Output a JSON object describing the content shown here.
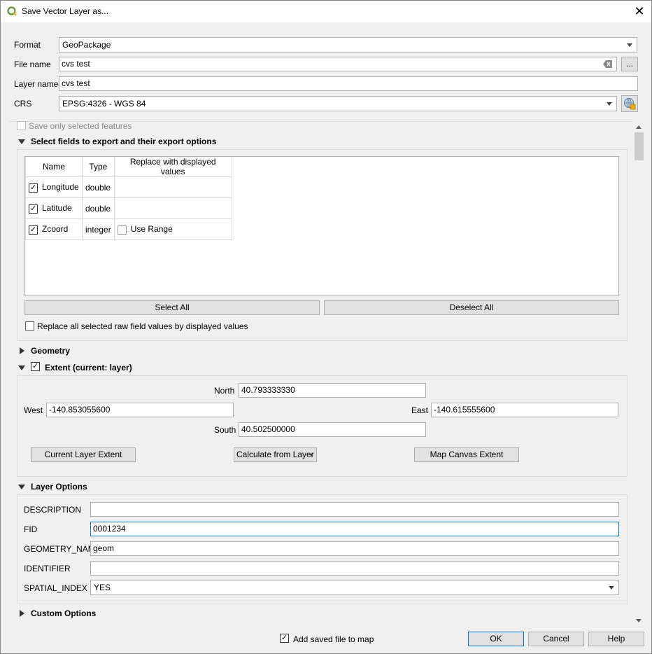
{
  "window": {
    "title": "Save Vector Layer as...",
    "close_glyph": "✕"
  },
  "top": {
    "format_label": "Format",
    "format_value": "GeoPackage",
    "filename_label": "File name",
    "filename_value": "cvs test",
    "browse_label": "...",
    "layername_label": "Layer name",
    "layername_value": "cvs test",
    "crs_label": "CRS",
    "crs_value": "EPSG:4326 - WGS 84"
  },
  "selected_only": {
    "label": "Save only selected features"
  },
  "fields_section": {
    "title": "Select fields to export and their export options",
    "columns": [
      "Name",
      "Type",
      "Replace with displayed values"
    ],
    "rows": [
      {
        "checked": true,
        "name": "Longitude",
        "type": "double",
        "replace": ""
      },
      {
        "checked": true,
        "name": "Latitude",
        "type": "double",
        "replace": ""
      },
      {
        "checked": true,
        "name": "Zcoord",
        "type": "integer",
        "replace": "Use Range"
      }
    ],
    "select_all": "Select All",
    "deselect_all": "Deselect All",
    "replace_all_label": "Replace all selected raw field values by displayed values"
  },
  "geometry_section": {
    "title": "Geometry"
  },
  "extent_section": {
    "title": "Extent (current: layer)",
    "north_label": "North",
    "north_value": "40.793333330",
    "west_label": "West",
    "west_value": "-140.853055600",
    "east_label": "East",
    "east_value": "-140.615555600",
    "south_label": "South",
    "south_value": "40.502500000",
    "current_layer_btn": "Current Layer Extent",
    "calc_from_layer_btn": "Calculate from Layer",
    "map_canvas_btn": "Map Canvas Extent"
  },
  "layer_options": {
    "title": "Layer Options",
    "description_label": "DESCRIPTION",
    "description_value": "",
    "fid_label": "FID",
    "fid_value": "0001234",
    "geometry_name_label": "GEOMETRY_NAME",
    "geometry_name_value": "geom",
    "identifier_label": "IDENTIFIER",
    "identifier_value": "",
    "spatial_index_label": "SPATIAL_INDEX",
    "spatial_index_value": "YES"
  },
  "custom_options": {
    "title": "Custom Options"
  },
  "footer": {
    "add_to_map_label": "Add saved file to map",
    "ok": "OK",
    "cancel": "Cancel",
    "help": "Help"
  },
  "check_glyph": "✓",
  "colors": {
    "accent": "#0078d7",
    "qgis_green": "#589632"
  }
}
